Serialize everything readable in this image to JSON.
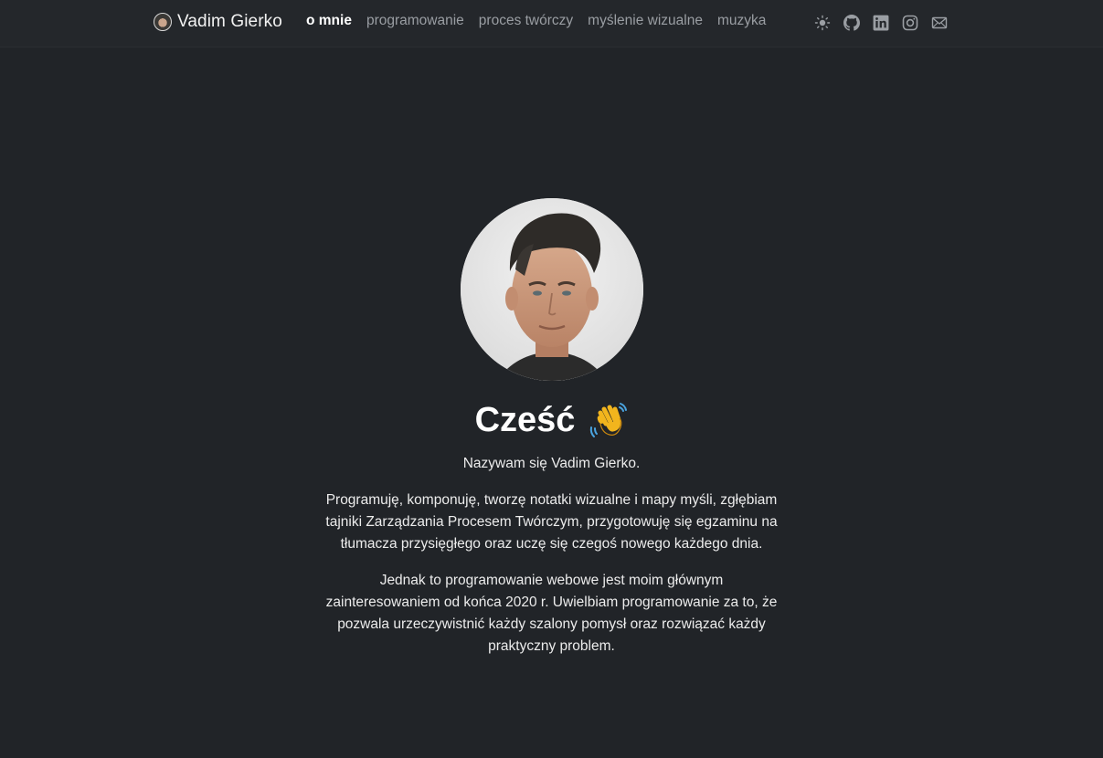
{
  "nav": {
    "brand": "Vadim Gierko",
    "links": [
      {
        "label": "o mnie",
        "active": true
      },
      {
        "label": "programowanie",
        "active": false
      },
      {
        "label": "proces twórczy",
        "active": false
      },
      {
        "label": "myślenie wizualne",
        "active": false
      },
      {
        "label": "muzyka",
        "active": false
      }
    ],
    "icons": [
      "theme-toggle-sun-icon",
      "github-icon",
      "linkedin-icon",
      "instagram-icon",
      "email-icon"
    ]
  },
  "hero": {
    "greeting": "Cześć",
    "greeting_emoji": "waving-hand-icon",
    "intro": "Nazywam się Vadim Gierko.",
    "paragraph_1": "Programuję, komponuję, tworzę notatki wizualne i mapy myśli, zgłębiam tajniki Zarządzania Procesem Twórczym, przygotowuję się egzaminu na tłumacza przysięgłego oraz uczę się czegoś nowego każdego dnia.",
    "paragraph_2": "Jednak to programowanie webowe jest moim głównym zainteresowaniem od końca 2020 r. Uwielbiam programowanie za to, że pozwala urzeczywistnić każdy szalony pomysł oraz rozwiązać każdy praktyczny problem."
  },
  "colors": {
    "background": "#212428",
    "navbar": "#24272b",
    "nav_active": "#ffffff",
    "nav_inactive": "#9a9ea3",
    "text": "#ececec"
  }
}
